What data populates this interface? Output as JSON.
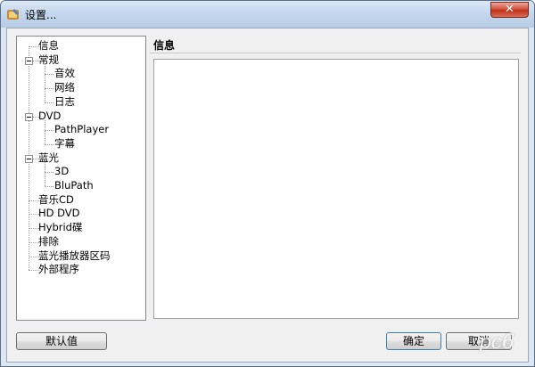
{
  "window": {
    "title": "设置...",
    "close_label": "✕"
  },
  "tree": {
    "items": [
      {
        "label": "信息",
        "level": 0,
        "expandable": false
      },
      {
        "label": "常规",
        "level": 0,
        "expandable": true
      },
      {
        "label": "音效",
        "level": 1,
        "expandable": false
      },
      {
        "label": "网络",
        "level": 1,
        "expandable": false
      },
      {
        "label": "日志",
        "level": 1,
        "expandable": false
      },
      {
        "label": "DVD",
        "level": 0,
        "expandable": true
      },
      {
        "label": "PathPlayer",
        "level": 1,
        "expandable": false
      },
      {
        "label": "字幕",
        "level": 1,
        "expandable": false
      },
      {
        "label": "蓝光",
        "level": 0,
        "expandable": true
      },
      {
        "label": "3D",
        "level": 1,
        "expandable": false
      },
      {
        "label": "BluPath",
        "level": 1,
        "expandable": false
      },
      {
        "label": "音乐CD",
        "level": 0,
        "expandable": false
      },
      {
        "label": "HD DVD",
        "level": 0,
        "expandable": false
      },
      {
        "label": "Hybrid碟",
        "level": 0,
        "expandable": false
      },
      {
        "label": "排除",
        "level": 0,
        "expandable": false
      },
      {
        "label": "蓝光播放器区码",
        "level": 0,
        "expandable": false
      },
      {
        "label": "外部程序",
        "level": 0,
        "expandable": false
      }
    ]
  },
  "panel": {
    "title": "信息"
  },
  "buttons": {
    "defaults": "默认值",
    "ok": "确定",
    "cancel": "取消"
  },
  "watermark": "pc6"
}
